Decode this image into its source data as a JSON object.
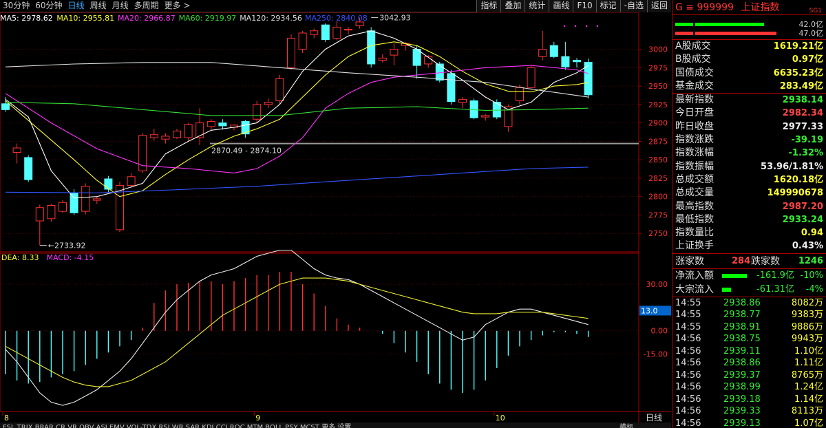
{
  "toolbar": {
    "periods": [
      "30分钟",
      "60分钟",
      "日线",
      "周线",
      "月线",
      "多周期",
      "更多 >"
    ],
    "active_period": "日线",
    "buttons": [
      "指标",
      "叠加",
      "统计",
      "画线",
      "F10",
      "标记",
      "-自选",
      "返回"
    ]
  },
  "ma_legend": [
    {
      "label": "MA5: 2978.62",
      "color": "#ffffff"
    },
    {
      "label": "MA10: 2955.81",
      "color": "#ffff33"
    },
    {
      "label": "MA20: 2966.87",
      "color": "#ff33ff"
    },
    {
      "label": "MA60: 2919.97",
      "color": "#33dd33"
    },
    {
      "label": "MA120: 2934.56",
      "color": "#dddddd"
    },
    {
      "label": "MA250: 2840.08",
      "color": "#3355ff"
    }
  ],
  "macd_legend": [
    {
      "label": "DEA: 8.33",
      "color": "#ffff33"
    },
    {
      "label": "MACD: -4.15",
      "color": "#ff33ff"
    }
  ],
  "chart_data": {
    "type": "candlestick",
    "price_axis": {
      "ticks": [
        3000,
        2975,
        2950,
        2925,
        2900,
        2875,
        2850,
        2825,
        2800,
        2775,
        2750
      ],
      "range": [
        2725,
        3050
      ]
    },
    "macd_axis": {
      "ticks": [
        30.0,
        0.0,
        -15.0
      ],
      "range": [
        -52,
        50
      ],
      "cursor_label": "13.0"
    },
    "annotations": [
      {
        "text": "3042.93",
        "price": 3042.93,
        "index": 32
      },
      {
        "text": "2733.92",
        "price": 2733.92,
        "index": 3
      },
      {
        "text": "2870.49 - 2874.10",
        "price": 2872
      }
    ],
    "reference_price": 2872,
    "dates": [
      "8",
      "9",
      "10"
    ],
    "date_indices": [
      0,
      22,
      43
    ],
    "candles": [
      {
        "o": 2926,
        "h": 2935,
        "l": 2915,
        "c": 2918
      },
      {
        "o": 2860,
        "h": 2872,
        "l": 2845,
        "c": 2866
      },
      {
        "o": 2853,
        "h": 2856,
        "l": 2820,
        "c": 2823
      },
      {
        "o": 2767,
        "h": 2789,
        "l": 2733.92,
        "c": 2785
      },
      {
        "o": 2770,
        "h": 2790,
        "l": 2766,
        "c": 2788
      },
      {
        "o": 2780,
        "h": 2795,
        "l": 2778,
        "c": 2792
      },
      {
        "o": 2805,
        "h": 2810,
        "l": 2775,
        "c": 2778
      },
      {
        "o": 2780,
        "h": 2818,
        "l": 2776,
        "c": 2814
      },
      {
        "o": 2795,
        "h": 2800,
        "l": 2790,
        "c": 2797
      },
      {
        "o": 2824,
        "h": 2828,
        "l": 2806,
        "c": 2810
      },
      {
        "o": 2755,
        "h": 2820,
        "l": 2752,
        "c": 2815
      },
      {
        "o": 2815,
        "h": 2832,
        "l": 2812,
        "c": 2827
      },
      {
        "o": 2835,
        "h": 2886,
        "l": 2832,
        "c": 2883
      },
      {
        "o": 2880,
        "h": 2892,
        "l": 2876,
        "c": 2884
      },
      {
        "o": 2878,
        "h": 2886,
        "l": 2872,
        "c": 2882
      },
      {
        "o": 2880,
        "h": 2892,
        "l": 2878,
        "c": 2889
      },
      {
        "o": 2880,
        "h": 2900,
        "l": 2876,
        "c": 2898
      },
      {
        "o": 2880,
        "h": 2920,
        "l": 2870,
        "c": 2900
      },
      {
        "o": 2895,
        "h": 2905,
        "l": 2890,
        "c": 2902
      },
      {
        "o": 2900,
        "h": 2905,
        "l": 2891,
        "c": 2896
      },
      {
        "o": 2894,
        "h": 2898,
        "l": 2890,
        "c": 2897
      },
      {
        "o": 2902,
        "h": 2904,
        "l": 2880,
        "c": 2885
      },
      {
        "o": 2905,
        "h": 2930,
        "l": 2900,
        "c": 2925
      },
      {
        "o": 2925,
        "h": 2933,
        "l": 2920,
        "c": 2928
      },
      {
        "o": 2930,
        "h": 2965,
        "l": 2925,
        "c": 2960
      },
      {
        "o": 2975,
        "h": 3020,
        "l": 2972,
        "c": 3015
      },
      {
        "o": 3000,
        "h": 3025,
        "l": 2995,
        "c": 3022
      },
      {
        "o": 3020,
        "h": 3028,
        "l": 3015,
        "c": 3025
      },
      {
        "o": 3033,
        "h": 3035,
        "l": 3010,
        "c": 3013
      },
      {
        "o": 3015,
        "h": 3038,
        "l": 3012,
        "c": 3030
      },
      {
        "o": 3027,
        "h": 3030,
        "l": 3020,
        "c": 3027
      },
      {
        "o": 3032,
        "h": 3042.93,
        "l": 3028,
        "c": 3037
      },
      {
        "o": 3025,
        "h": 3030,
        "l": 2975,
        "c": 2980
      },
      {
        "o": 2985,
        "h": 2993,
        "l": 2982,
        "c": 2988
      },
      {
        "o": 2992,
        "h": 3008,
        "l": 2978,
        "c": 3000
      },
      {
        "o": 3005,
        "h": 3010,
        "l": 2998,
        "c": 3008
      },
      {
        "o": 3000,
        "h": 3005,
        "l": 2960,
        "c": 2978
      },
      {
        "o": 2980,
        "h": 2992,
        "l": 2975,
        "c": 2990
      },
      {
        "o": 2980,
        "h": 2983,
        "l": 2955,
        "c": 2958
      },
      {
        "o": 2967,
        "h": 2972,
        "l": 2925,
        "c": 2929
      },
      {
        "o": 2928,
        "h": 2935,
        "l": 2920,
        "c": 2932
      },
      {
        "o": 2930,
        "h": 2933,
        "l": 2905,
        "c": 2907
      },
      {
        "o": 2908,
        "h": 2912,
        "l": 2903,
        "c": 2910
      },
      {
        "o": 2928,
        "h": 2932,
        "l": 2905,
        "c": 2908
      },
      {
        "o": 2895,
        "h": 2925,
        "l": 2888,
        "c": 2922
      },
      {
        "o": 2930,
        "h": 2952,
        "l": 2925,
        "c": 2948
      },
      {
        "o": 2948,
        "h": 2978,
        "l": 2945,
        "c": 2975
      },
      {
        "o": 2990,
        "h": 3025,
        "l": 2985,
        "c": 3000
      },
      {
        "o": 3005,
        "h": 3010,
        "l": 2988,
        "c": 2990
      },
      {
        "o": 2990,
        "h": 3010,
        "l": 2972,
        "c": 2976
      },
      {
        "o": 2985,
        "h": 2988,
        "l": 2975,
        "c": 2983
      },
      {
        "o": 2982.34,
        "h": 2987.2,
        "l": 2933.24,
        "c": 2938.14
      }
    ],
    "ma_series": [
      {
        "label": "MA5",
        "color": "#ffffff",
        "values": [
          [
            0,
            2932
          ],
          [
            2,
            2908
          ],
          [
            4,
            2835
          ],
          [
            6,
            2798
          ],
          [
            8,
            2800
          ],
          [
            10,
            2808
          ],
          [
            12,
            2818
          ],
          [
            14,
            2858
          ],
          [
            16,
            2875
          ],
          [
            18,
            2890
          ],
          [
            20,
            2894
          ],
          [
            22,
            2900
          ],
          [
            24,
            2925
          ],
          [
            26,
            2970
          ],
          [
            28,
            3000
          ],
          [
            30,
            3018
          ],
          [
            32,
            3025
          ],
          [
            34,
            3015
          ],
          [
            36,
            3000
          ],
          [
            38,
            2978
          ],
          [
            40,
            2958
          ],
          [
            42,
            2935
          ],
          [
            44,
            2918
          ],
          [
            46,
            2928
          ],
          [
            48,
            2955
          ],
          [
            50,
            2968
          ],
          [
            51,
            2978
          ]
        ]
      },
      {
        "label": "MA10",
        "color": "#ffff33",
        "values": [
          [
            0,
            2930
          ],
          [
            3,
            2890
          ],
          [
            6,
            2850
          ],
          [
            8,
            2822
          ],
          [
            10,
            2800
          ],
          [
            12,
            2808
          ],
          [
            14,
            2830
          ],
          [
            16,
            2850
          ],
          [
            18,
            2868
          ],
          [
            20,
            2882
          ],
          [
            22,
            2892
          ],
          [
            24,
            2905
          ],
          [
            26,
            2935
          ],
          [
            28,
            2965
          ],
          [
            30,
            2990
          ],
          [
            32,
            3005
          ],
          [
            34,
            3010
          ],
          [
            36,
            3005
          ],
          [
            38,
            2990
          ],
          [
            40,
            2970
          ],
          [
            42,
            2953
          ],
          [
            44,
            2943
          ],
          [
            46,
            2942
          ],
          [
            48,
            2950
          ],
          [
            50,
            2952
          ],
          [
            51,
            2955
          ]
        ]
      },
      {
        "label": "MA20",
        "color": "#ff33ff",
        "values": [
          [
            0,
            2940
          ],
          [
            4,
            2900
          ],
          [
            8,
            2865
          ],
          [
            12,
            2842
          ],
          [
            16,
            2838
          ],
          [
            20,
            2832
          ],
          [
            22,
            2838
          ],
          [
            24,
            2855
          ],
          [
            26,
            2880
          ],
          [
            28,
            2920
          ],
          [
            30,
            2940
          ],
          [
            32,
            2955
          ],
          [
            34,
            2962
          ],
          [
            38,
            2968
          ],
          [
            42,
            2975
          ],
          [
            46,
            2978
          ],
          [
            50,
            2972
          ],
          [
            51,
            2967
          ]
        ]
      },
      {
        "label": "MA60",
        "color": "#33dd33",
        "values": [
          [
            0,
            2928
          ],
          [
            6,
            2926
          ],
          [
            12,
            2918
          ],
          [
            18,
            2910
          ],
          [
            24,
            2910
          ],
          [
            30,
            2920
          ],
          [
            36,
            2922
          ],
          [
            42,
            2917
          ],
          [
            46,
            2918
          ],
          [
            51,
            2920
          ]
        ]
      },
      {
        "label": "MA120",
        "color": "#dddddd",
        "values": [
          [
            0,
            2976
          ],
          [
            6,
            2980
          ],
          [
            12,
            2982
          ],
          [
            18,
            2982
          ],
          [
            24,
            2975
          ],
          [
            30,
            2968
          ],
          [
            36,
            2962
          ],
          [
            42,
            2955
          ],
          [
            46,
            2946
          ],
          [
            51,
            2935
          ]
        ]
      },
      {
        "label": "MA250",
        "color": "#3355ff",
        "values": [
          [
            0,
            2806
          ],
          [
            8,
            2805
          ],
          [
            16,
            2810
          ],
          [
            22,
            2814
          ],
          [
            30,
            2822
          ],
          [
            38,
            2830
          ],
          [
            46,
            2838
          ],
          [
            51,
            2840
          ]
        ]
      }
    ],
    "macd_bars": [
      -28,
      -32,
      -34,
      -33,
      -30,
      -28,
      -26,
      -22,
      -18,
      -14,
      -10,
      -6,
      2,
      18,
      26,
      30,
      31,
      32,
      32,
      30,
      32,
      34,
      36,
      36,
      38,
      38,
      30,
      24,
      16,
      8,
      4,
      2,
      0,
      -2,
      -8,
      -14,
      -20,
      -28,
      -34,
      -38,
      -40,
      -38,
      -32,
      -24,
      -16,
      -10,
      -6,
      -3,
      -1,
      -1,
      -2,
      -4
    ],
    "dif": [
      -12,
      -20,
      -30,
      -40,
      -46,
      -48,
      -46,
      -42,
      -38,
      -32,
      -26,
      -18,
      -8,
      2,
      12,
      20,
      26,
      32,
      36,
      38,
      40,
      44,
      48,
      50,
      52,
      52,
      46,
      40,
      36,
      34,
      33,
      30,
      26,
      22,
      18,
      14,
      10,
      6,
      2,
      -2,
      -6,
      -4,
      4,
      8,
      12,
      14,
      14,
      12,
      10,
      8,
      6,
      4
    ],
    "dea": [
      -10,
      -14,
      -18,
      -22,
      -26,
      -30,
      -33,
      -35,
      -36,
      -36,
      -34,
      -32,
      -28,
      -24,
      -20,
      -14,
      -8,
      -2,
      4,
      10,
      14,
      18,
      22,
      26,
      30,
      32,
      34,
      34,
      34,
      33,
      32,
      30,
      28,
      26,
      24,
      22,
      20,
      18,
      16,
      14,
      12,
      11,
      11,
      11,
      12,
      12,
      12,
      12,
      11,
      10,
      9,
      8
    ]
  },
  "quote": {
    "code": "G ≡ 999999",
    "name": "上证指数",
    "badge": "SG1",
    "up_ratio": "42.0亿",
    "down_ratio": "47.0亿",
    "group1": [
      {
        "label": "A股成交",
        "value": "1619.21亿",
        "color": "yl"
      },
      {
        "label": "B股成交",
        "value": "0.97亿",
        "color": "yl"
      },
      {
        "label": "国债成交",
        "value": "6635.23亿",
        "color": "yl"
      },
      {
        "label": "基金成交",
        "value": "283.49亿",
        "color": "yl"
      }
    ],
    "group2": [
      {
        "label": "最新指数",
        "value": "2938.14",
        "color": "dn"
      },
      {
        "label": "今日开盘",
        "value": "2982.34",
        "color": "up"
      },
      {
        "label": "昨日收盘",
        "value": "2977.33",
        "color": "wh"
      },
      {
        "label": "指数涨跌",
        "value": "-39.19",
        "color": "dn"
      },
      {
        "label": "指数涨幅",
        "value": "-1.32%",
        "color": "dn"
      },
      {
        "label": "指数振幅",
        "value": "53.96/1.81%",
        "color": "wh"
      },
      {
        "label": "总成交额",
        "value": "1620.18亿",
        "color": "yl"
      },
      {
        "label": "总成交量",
        "value": "149990678",
        "color": "yl"
      },
      {
        "label": "最高指数",
        "value": "2987.20",
        "color": "up"
      },
      {
        "label": "最低指数",
        "value": "2933.24",
        "color": "dn"
      },
      {
        "label": "指数量比",
        "value": "0.94",
        "color": "yl"
      },
      {
        "label": "上证换手",
        "value": "0.43%",
        "color": "wh"
      }
    ],
    "counts": {
      "up_label": "涨家数",
      "up_value": "284",
      "down_label": "跌家数",
      "down_value": "1246"
    },
    "flows": [
      {
        "label": "净流入额",
        "value": "-161.9亿",
        "pct": "-10%",
        "bar": 60
      },
      {
        "label": "大宗流入",
        "value": "-61.31亿",
        "pct": "-4%",
        "bar": 22
      }
    ],
    "ticks": [
      {
        "time": "14:55",
        "price": "2938.86",
        "vol": "8082万"
      },
      {
        "time": "14:55",
        "price": "2938.77",
        "vol": "9383万"
      },
      {
        "time": "14:55",
        "price": "2938.91",
        "vol": "9886万"
      },
      {
        "time": "14:56",
        "price": "2938.75",
        "vol": "9943万"
      },
      {
        "time": "14:56",
        "price": "2939.11",
        "vol": "1.10亿"
      },
      {
        "time": "14:56",
        "price": "2938.86",
        "vol": "1.11亿"
      },
      {
        "time": "14:56",
        "price": "2939.37",
        "vol": "8765万"
      },
      {
        "time": "14:56",
        "price": "2938.99",
        "vol": "1.24亿"
      },
      {
        "time": "14:56",
        "price": "2939.18",
        "vol": "1.14亿"
      },
      {
        "time": "14:56",
        "price": "2939.33",
        "vol": "8113万"
      },
      {
        "time": "14:56",
        "price": "2939.13",
        "vol": "1.07亿"
      }
    ]
  },
  "bottom": {
    "indicator_tabs": "FSL  TRIX  BRAR  CR  VR  OBV  ASI  EMV  VOL-TDX  RSI  WR  SAR  KDJ  CCI  ROC  MTM  BOLL  PSY  MCST  更多  设置",
    "period_label": "日线",
    "right_tab": "横标"
  }
}
